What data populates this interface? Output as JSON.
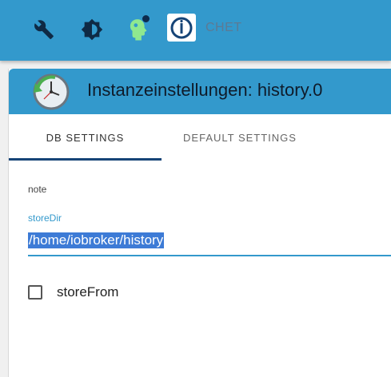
{
  "topbar": {
    "icons": [
      "wrench-icon",
      "theme-icon",
      "expert-mode-icon",
      "iobroker-logo"
    ],
    "brand_text": "CHET",
    "background": "#3399cc"
  },
  "panel": {
    "title": "Instanzeinstellungen: history.0",
    "icon": "clock-history-icon",
    "tabs": [
      {
        "label": "DB SETTINGS",
        "selected": true
      },
      {
        "label": "DEFAULT SETTINGS",
        "selected": false
      }
    ]
  },
  "form": {
    "note_label": "note",
    "store_dir": {
      "label": "storeDir",
      "value": "/home/iobroker/history"
    },
    "store_from": {
      "label": "storeFrom",
      "checked": false
    }
  },
  "colors": {
    "accent": "#3399cc",
    "tab_indicator": "#164477",
    "selection": "#3d7bd6"
  }
}
